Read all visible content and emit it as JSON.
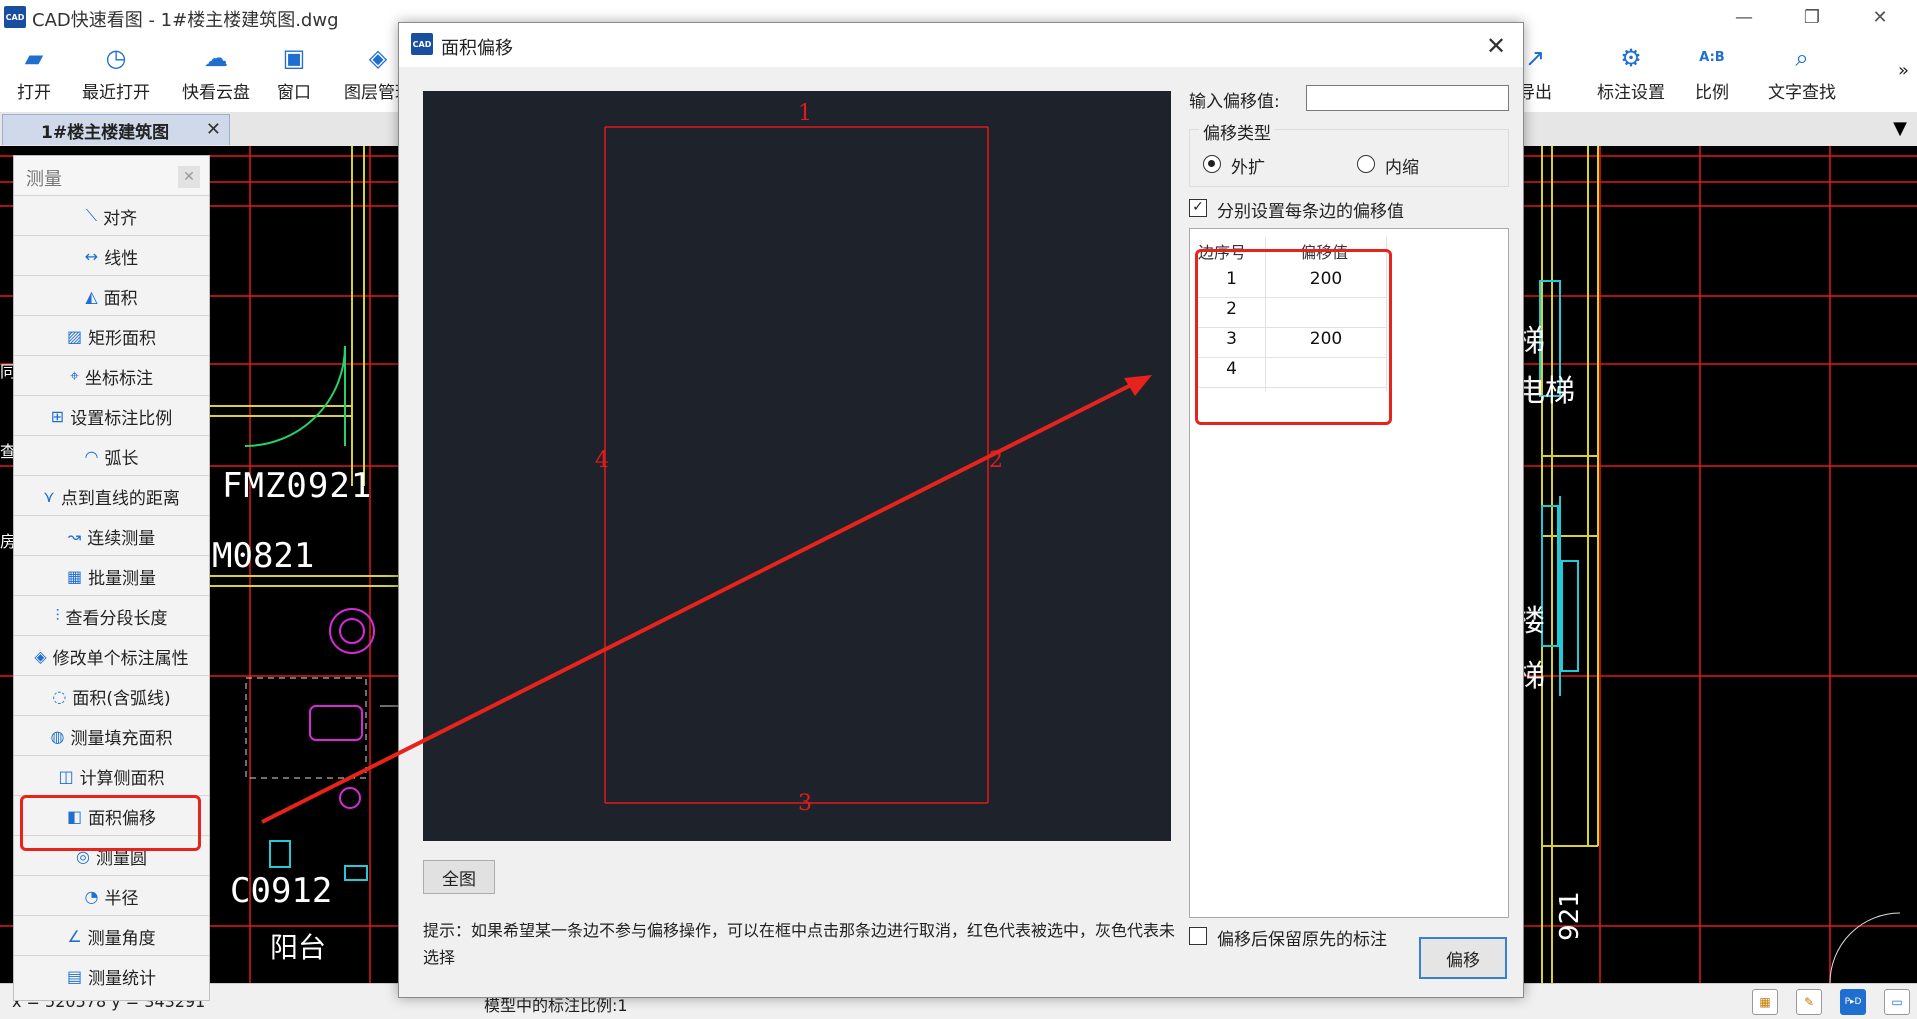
{
  "app": {
    "title": "CAD快速看图 - 1#楼主楼建筑图.dwg",
    "logo_text": "CAD"
  },
  "toolbar": {
    "items": [
      {
        "label": "打开",
        "icon": "folder-open-icon"
      },
      {
        "label": "最近打开",
        "icon": "history-icon"
      },
      {
        "label": "快看云盘",
        "icon": "cloud-icon"
      },
      {
        "label": "窗口",
        "icon": "window-icon"
      },
      {
        "label": "图层管理",
        "icon": "layers-icon"
      },
      {
        "label": "导出",
        "icon": "export-icon"
      },
      {
        "label": "标注设置",
        "icon": "annotation-settings-icon"
      },
      {
        "label": "比例",
        "icon": "scale-icon"
      },
      {
        "label": "文字查找",
        "icon": "text-search-icon"
      }
    ],
    "more": "»"
  },
  "tabs": {
    "active_label": "1#楼主楼建筑图",
    "close": "✕"
  },
  "canvas": {
    "texts": [
      "FMZ0921",
      "M0821",
      "C0912",
      "阳台",
      "梯",
      "电梯",
      "楼",
      "梯",
      "921"
    ],
    "side_labels": [
      "同",
      "查",
      "房"
    ]
  },
  "status": {
    "coords": "x = 520578  y = 343291",
    "scale": "模型中的标注比例:1"
  },
  "measure_panel": {
    "title": "测量",
    "close": "✕",
    "items": [
      {
        "label": "对齐",
        "icon": "align-measure-icon"
      },
      {
        "label": "线性",
        "icon": "linear-measure-icon"
      },
      {
        "label": "面积",
        "icon": "area-icon"
      },
      {
        "label": "矩形面积",
        "icon": "rect-area-icon"
      },
      {
        "label": "坐标标注",
        "icon": "coordinate-icon"
      },
      {
        "label": "设置标注比例",
        "icon": "scale-set-icon"
      },
      {
        "label": "弧长",
        "icon": "arc-length-icon"
      },
      {
        "label": "点到直线的距离",
        "icon": "point-line-icon"
      },
      {
        "label": "连续测量",
        "icon": "continuous-measure-icon"
      },
      {
        "label": "批量测量",
        "icon": "batch-measure-icon"
      },
      {
        "label": "查看分段长度",
        "icon": "segment-length-icon"
      },
      {
        "label": "修改单个标注属性",
        "icon": "edit-annotation-icon"
      },
      {
        "label": "面积(含弧线)",
        "icon": "arc-area-icon"
      },
      {
        "label": "测量填充面积",
        "icon": "fill-area-icon"
      },
      {
        "label": "计算侧面积",
        "icon": "side-area-icon"
      },
      {
        "label": "面积偏移",
        "icon": "area-offset-icon"
      },
      {
        "label": "测量圆",
        "icon": "circle-measure-icon"
      },
      {
        "label": "半径",
        "icon": "radius-icon"
      },
      {
        "label": "测量角度",
        "icon": "angle-icon"
      },
      {
        "label": "测量统计",
        "icon": "statistics-icon"
      }
    ]
  },
  "dialog": {
    "title": "面积偏移",
    "logo_text": "CAD",
    "close": "✕",
    "preview": {
      "edges": [
        "1",
        "2",
        "3",
        "4"
      ]
    },
    "fit_button": "全图",
    "hint": "提示：如果希望某一条边不参与偏移操作，可以在框中点击那条边进行取消，红色代表被选中，灰色代表未选择",
    "offset_label": "输入偏移值:",
    "offset_value": "",
    "type_group": {
      "legend": "偏移类型",
      "options": [
        "外扩",
        "内缩"
      ],
      "selected": "外扩"
    },
    "each_edge_label": "分别设置每条边的偏移值",
    "each_edge_checked": "✓",
    "table": {
      "headers": [
        "边序号",
        "偏移值"
      ],
      "rows": [
        {
          "edge": "1",
          "value": "200"
        },
        {
          "edge": "2",
          "value": ""
        },
        {
          "edge": "3",
          "value": "200"
        },
        {
          "edge": "4",
          "value": ""
        }
      ]
    },
    "keep_label": "偏移后保留原先的标注",
    "offset_button": "偏移"
  },
  "colors": {
    "accent": "#1f6fd1",
    "highlight": "#e8231b",
    "cad_background": "#000000",
    "preview_background": "#1e232b"
  }
}
